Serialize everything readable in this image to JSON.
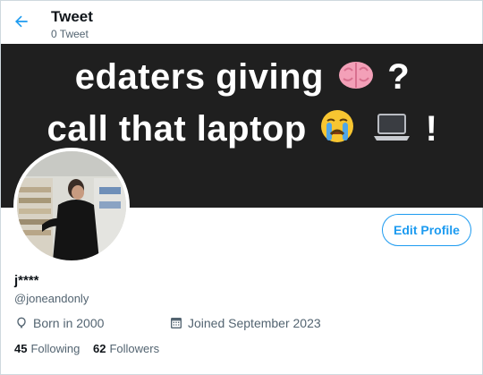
{
  "header": {
    "title": "Tweet",
    "subtitle": "0 Tweet",
    "back_icon": "arrow-left-icon"
  },
  "banner": {
    "line1_text": "edaters giving",
    "line1_suffix": "?",
    "line2_text": "call that laptop",
    "line2_suffix": "!",
    "emojis": [
      "brain-emoji",
      "crying-face-emoji",
      "laptop-emoji"
    ]
  },
  "profile": {
    "display_name": "j****",
    "handle": "@joneandonly",
    "edit_button_label": "Edit Profile",
    "born": "Born in 2000",
    "joined": "Joined September 2023",
    "following_count": "45",
    "following_label": "Following",
    "followers_count": "62",
    "followers_label": "Followers"
  },
  "colors": {
    "accent": "#1d9bf0",
    "secondary_text": "#536471",
    "banner_bg": "#1f1f1f"
  }
}
